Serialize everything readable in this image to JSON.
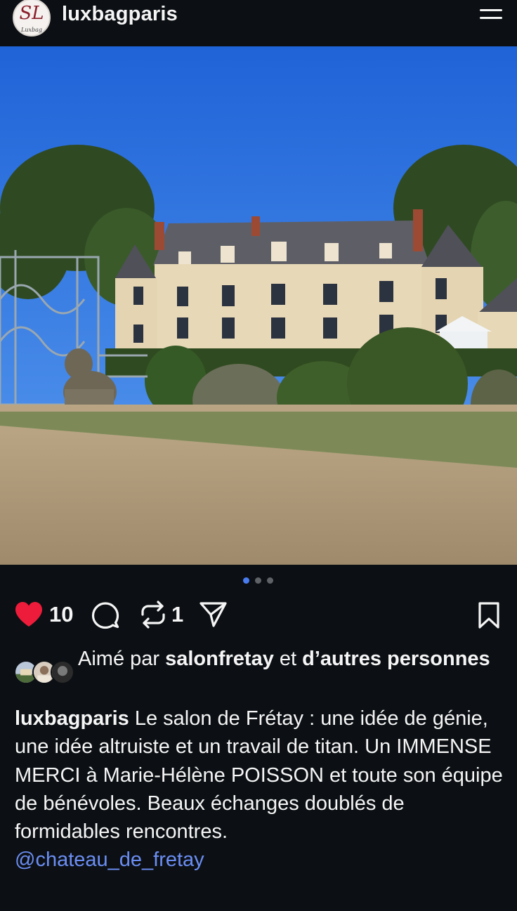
{
  "header": {
    "username": "luxbagparis",
    "avatar_monogram": "SL",
    "avatar_text": "Luxbag",
    "menu_icon": "hamburger-menu-icon"
  },
  "post": {
    "image_icon": "photo-chateau",
    "carousel": {
      "count": 3,
      "active_index": 0,
      "active_color": "#4a7cf0",
      "inactive_color": "#5f6368"
    }
  },
  "actions": {
    "like_count": "10",
    "repost_count": "1",
    "liked": true,
    "like_color": "#ed1c3a",
    "icons": [
      "heart-icon",
      "comment-icon",
      "repost-icon",
      "share-icon",
      "save-icon"
    ]
  },
  "likes": {
    "prefix": "Aimé par ",
    "user": "salonfretay",
    "connector": " et ",
    "others": "d’autres personnes"
  },
  "caption": {
    "author": "luxbagparis",
    "text": " Le salon de Frétay : une idée de génie, une idée altruiste et un travail de titan. Un IMMENSE MERCI à Marie-Hélène POISSON et toute son équipe de bénévoles. Beaux échanges doublés de formidables rencontres.",
    "mention": "@chateau_de_fretay",
    "mention_color": "#6b8ef4"
  }
}
